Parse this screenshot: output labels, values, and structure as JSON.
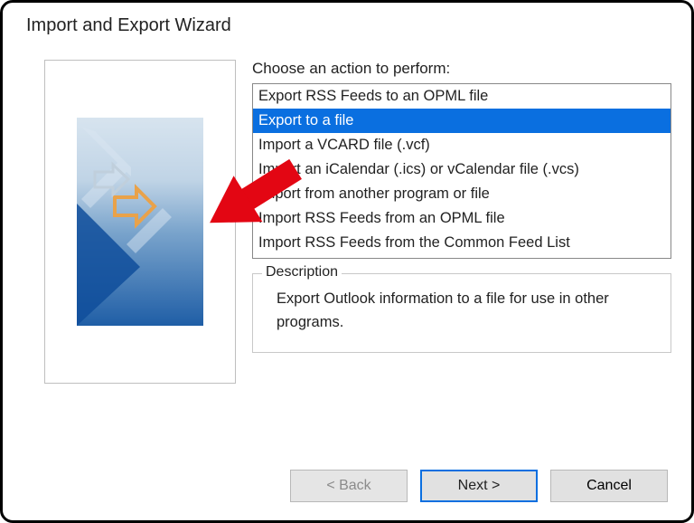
{
  "dialog": {
    "title": "Import and Export Wizard"
  },
  "prompt": "Choose an action to perform:",
  "actions": [
    "Export RSS Feeds to an OPML file",
    "Export to a file",
    "Import a VCARD file (.vcf)",
    "Import an iCalendar (.ics) or vCalendar file (.vcs)",
    "Import from another program or file",
    "Import RSS Feeds from an OPML file",
    "Import RSS Feeds from the Common Feed List"
  ],
  "selected_index": 1,
  "description": {
    "title": "Description",
    "body": "Export Outlook information to a file for use in other programs."
  },
  "buttons": {
    "back": "< Back",
    "next": "Next >",
    "cancel": "Cancel"
  }
}
